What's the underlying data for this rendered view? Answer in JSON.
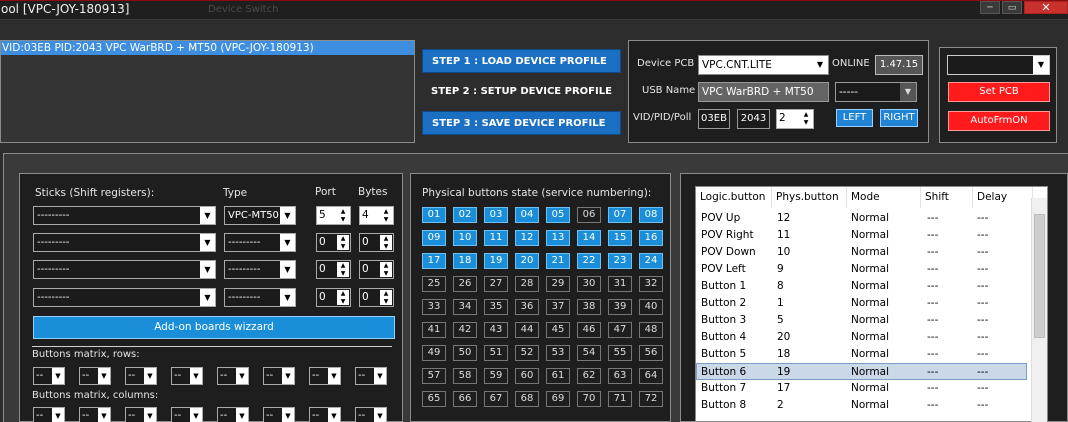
{
  "window": {
    "title": "ool [VPC-JOY-180913]",
    "ghost_title": "Device Switch",
    "minimize": "─",
    "maximize": "▭",
    "close": "✕"
  },
  "device_list": {
    "selected_device": "VID:03EB PID:2043 VPC WarBRD + MT50 (VPC-JOY-180913)"
  },
  "steps": {
    "step1": "STEP 1 : LOAD DEVICE PROFILE",
    "step2": "STEP 2 : SETUP DEVICE PROFILE",
    "step3": "STEP 3 : SAVE DEVICE PROFILE"
  },
  "pcb": {
    "device_pcb_label": "Device PCB",
    "device_pcb_value": "VPC.CNT.LITE",
    "online_label": "ONLINE",
    "version": "1.47.15",
    "usb_name_label": "USB Name",
    "usb_name_value": "VPC WarBRD + MT50",
    "usb_extra_value": "-----",
    "vid_pid_poll_label": "VID/PID/Poll",
    "vid": "03EB",
    "pid": "2043",
    "poll": "2",
    "left_button": "LEFT",
    "right_button": "RIGHT"
  },
  "side": {
    "combo_value": "",
    "set_pcb_button": "Set PCB",
    "autofrmon_button": "AutoFrmON"
  },
  "sticks": {
    "header_sticks": "Sticks (Shift registers):",
    "header_type": "Type",
    "header_port": "Port",
    "header_bytes": "Bytes",
    "rows": [
      {
        "stick": "---------",
        "type": "VPC-MT50",
        "port": "5",
        "bytes": "4"
      },
      {
        "stick": "---------",
        "type": "---------",
        "port": "0",
        "bytes": "0"
      },
      {
        "stick": "---------",
        "type": "---------",
        "port": "0",
        "bytes": "0"
      },
      {
        "stick": "---------",
        "type": "---------",
        "port": "0",
        "bytes": "0"
      }
    ],
    "wizard_button": "Add-on boards wizzard",
    "matrix_rows_label": "Buttons matrix, rows:",
    "matrix_cols_label": "Buttons matrix, columns:",
    "matrix_value": "--"
  },
  "physical_buttons": {
    "title": "Physical buttons state (service numbering):",
    "buttons": [
      {
        "label": "01",
        "on": true
      },
      {
        "label": "02",
        "on": true
      },
      {
        "label": "03",
        "on": true
      },
      {
        "label": "04",
        "on": true
      },
      {
        "label": "05",
        "on": true
      },
      {
        "label": "06",
        "on": false
      },
      {
        "label": "07",
        "on": true
      },
      {
        "label": "08",
        "on": true
      },
      {
        "label": "09",
        "on": true
      },
      {
        "label": "10",
        "on": true
      },
      {
        "label": "11",
        "on": true
      },
      {
        "label": "12",
        "on": true
      },
      {
        "label": "13",
        "on": true
      },
      {
        "label": "14",
        "on": true
      },
      {
        "label": "15",
        "on": true
      },
      {
        "label": "16",
        "on": true
      },
      {
        "label": "17",
        "on": true
      },
      {
        "label": "18",
        "on": true
      },
      {
        "label": "19",
        "on": true
      },
      {
        "label": "20",
        "on": true
      },
      {
        "label": "21",
        "on": true
      },
      {
        "label": "22",
        "on": true
      },
      {
        "label": "23",
        "on": true
      },
      {
        "label": "24",
        "on": true
      },
      {
        "label": "25",
        "on": false
      },
      {
        "label": "26",
        "on": false
      },
      {
        "label": "27",
        "on": false
      },
      {
        "label": "28",
        "on": false
      },
      {
        "label": "29",
        "on": false
      },
      {
        "label": "30",
        "on": false
      },
      {
        "label": "31",
        "on": false
      },
      {
        "label": "32",
        "on": false
      },
      {
        "label": "33",
        "on": false
      },
      {
        "label": "34",
        "on": false
      },
      {
        "label": "35",
        "on": false
      },
      {
        "label": "36",
        "on": false
      },
      {
        "label": "37",
        "on": false
      },
      {
        "label": "38",
        "on": false
      },
      {
        "label": "39",
        "on": false
      },
      {
        "label": "40",
        "on": false
      },
      {
        "label": "41",
        "on": false
      },
      {
        "label": "42",
        "on": false
      },
      {
        "label": "43",
        "on": false
      },
      {
        "label": "44",
        "on": false
      },
      {
        "label": "45",
        "on": false
      },
      {
        "label": "46",
        "on": false
      },
      {
        "label": "47",
        "on": false
      },
      {
        "label": "48",
        "on": false
      },
      {
        "label": "49",
        "on": false
      },
      {
        "label": "50",
        "on": false
      },
      {
        "label": "51",
        "on": false
      },
      {
        "label": "52",
        "on": false
      },
      {
        "label": "53",
        "on": false
      },
      {
        "label": "54",
        "on": false
      },
      {
        "label": "55",
        "on": false
      },
      {
        "label": "56",
        "on": false
      },
      {
        "label": "57",
        "on": false
      },
      {
        "label": "58",
        "on": false
      },
      {
        "label": "59",
        "on": false
      },
      {
        "label": "60",
        "on": false
      },
      {
        "label": "61",
        "on": false
      },
      {
        "label": "62",
        "on": false
      },
      {
        "label": "63",
        "on": false
      },
      {
        "label": "64",
        "on": false
      },
      {
        "label": "65",
        "on": false
      },
      {
        "label": "66",
        "on": false
      },
      {
        "label": "67",
        "on": false
      },
      {
        "label": "68",
        "on": false
      },
      {
        "label": "69",
        "on": false
      },
      {
        "label": "70",
        "on": false
      },
      {
        "label": "71",
        "on": false
      },
      {
        "label": "72",
        "on": false
      }
    ]
  },
  "mapping": {
    "columns": [
      "Logic.button",
      "Phys.button",
      "Mode",
      "Shift",
      "Delay"
    ],
    "rows": [
      {
        "logic": "POV Up",
        "phys": "12",
        "mode": "Normal",
        "shift": "---",
        "delay": "---"
      },
      {
        "logic": "POV Right",
        "phys": "11",
        "mode": "Normal",
        "shift": "---",
        "delay": "---"
      },
      {
        "logic": "POV Down",
        "phys": "10",
        "mode": "Normal",
        "shift": "---",
        "delay": "---"
      },
      {
        "logic": "POV Left",
        "phys": "9",
        "mode": "Normal",
        "shift": "---",
        "delay": "---"
      },
      {
        "logic": "Button 1",
        "phys": "8",
        "mode": "Normal",
        "shift": "---",
        "delay": "---"
      },
      {
        "logic": "Button 2",
        "phys": "1",
        "mode": "Normal",
        "shift": "---",
        "delay": "---"
      },
      {
        "logic": "Button 3",
        "phys": "5",
        "mode": "Normal",
        "shift": "---",
        "delay": "---"
      },
      {
        "logic": "Button 4",
        "phys": "20",
        "mode": "Normal",
        "shift": "---",
        "delay": "---"
      },
      {
        "logic": "Button 5",
        "phys": "18",
        "mode": "Normal",
        "shift": "---",
        "delay": "---"
      },
      {
        "logic": "Button 6",
        "phys": "19",
        "mode": "Normal",
        "shift": "---",
        "delay": "---"
      },
      {
        "logic": "Button 7",
        "phys": "17",
        "mode": "Normal",
        "shift": "---",
        "delay": "---"
      },
      {
        "logic": "Button 8",
        "phys": "2",
        "mode": "Normal",
        "shift": "---",
        "delay": "---"
      }
    ],
    "selected_index": 9
  },
  "colors": {
    "accent_blue": "#1a8ed8",
    "red_button": "#ff1b1b",
    "panel_bg": "#1e1e1e"
  }
}
